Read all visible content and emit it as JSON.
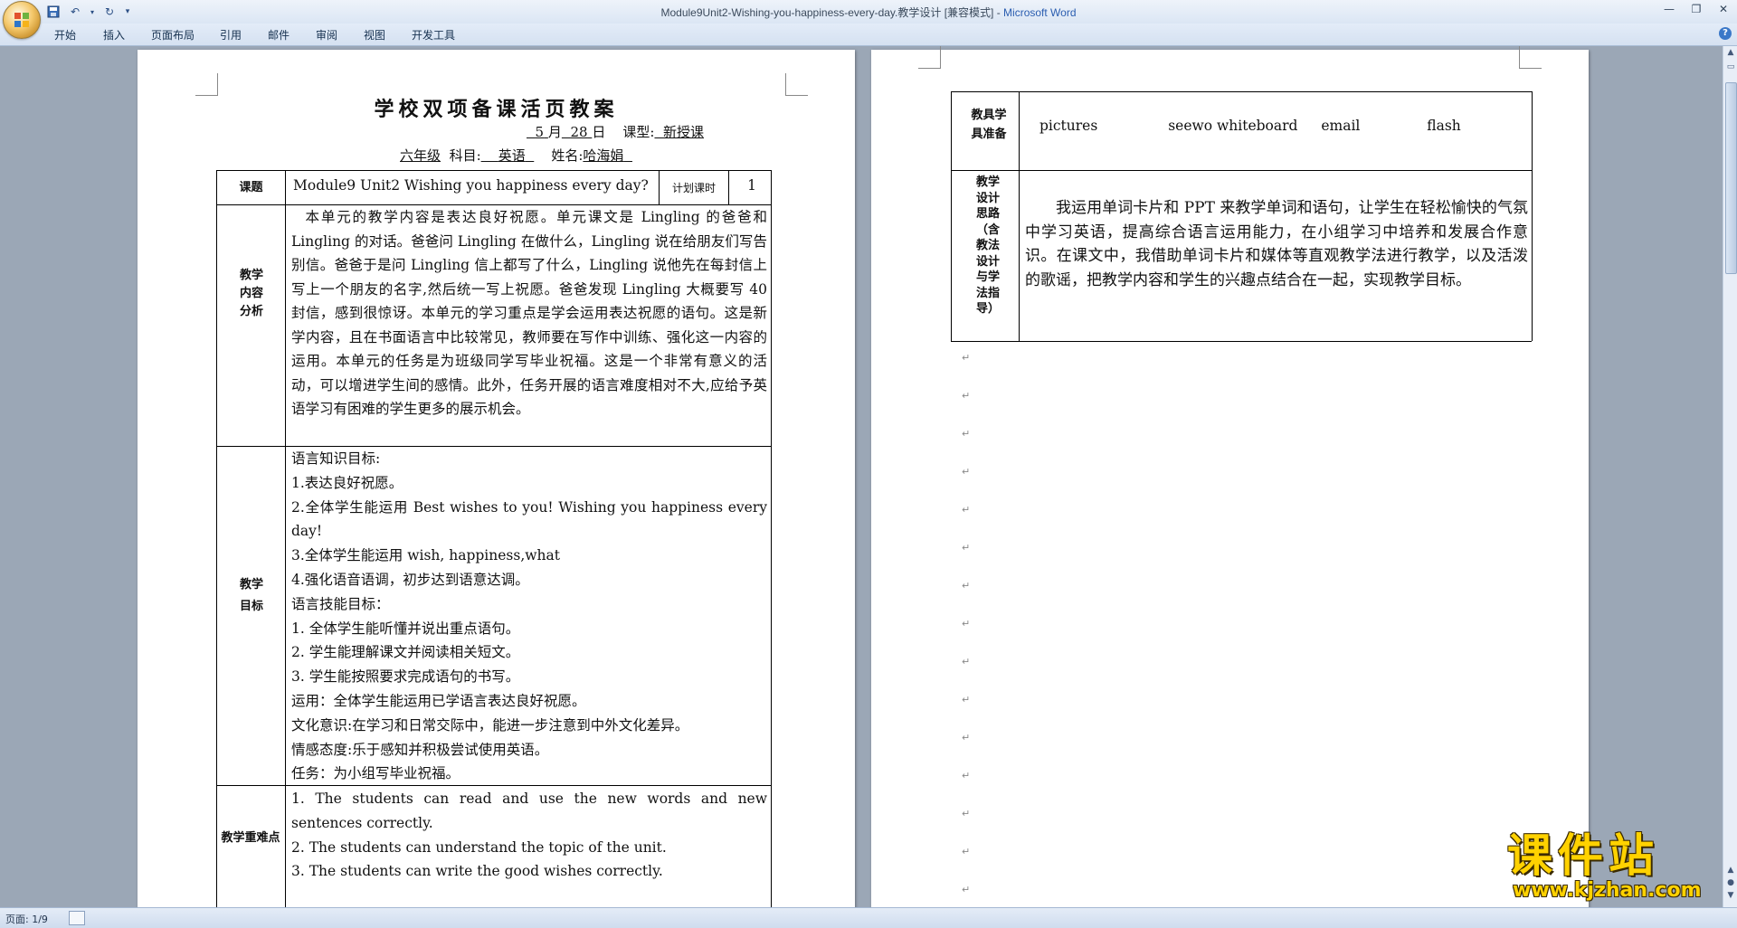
{
  "window": {
    "title": "Module9Unit2-Wishing-you-happiness-every-day.教学设计 [兼容模式] - ",
    "app_name": "Microsoft Word"
  },
  "ribbon": {
    "tabs": [
      "开始",
      "插入",
      "页面布局",
      "引用",
      "邮件",
      "审阅",
      "视图",
      "开发工具"
    ]
  },
  "status": {
    "page_label": "页面: 1/9"
  },
  "page1": {
    "title": "学校双项备课活页教案",
    "date_month": "5",
    "date_day": "28",
    "month_char": "月",
    "day_char": "日",
    "course_type_label": "课型:",
    "course_type": "新授课",
    "grade": "六年级",
    "subject_label": "科目:",
    "subject": "英语",
    "name_label": "姓名:",
    "name": "哈海娟",
    "topic_label": "课题",
    "topic": "Module9 Unit2 Wishing you happiness every day?",
    "hours_label": "计划课时",
    "hours": "1",
    "content_label": "教学内容分析",
    "content_text": "本单元的教学内容是表达良好祝愿。单元课文是 Lingling 的爸爸和 Lingling 的对话。爸爸问 Lingling 在做什么，Lingling 说在给朋友们写告别信。爸爸于是问 Lingling 信上都写了什么，Lingling 说他先在每封信上写上一个朋友的名字,然后统一写上祝愿。爸爸发现 Lingling 大概要写 40 封信，感到很惊讶。本单元的学习重点是学会运用表达祝愿的语句。这是新学内容，且在书面语言中比较常见，教师要在写作中训练、强化这一内容的运用。本单元的任务是为班级同学写毕业祝福。这是一个非常有意义的活动，可以增进学生间的感情。此外，任务开展的语言难度相对不大,应给予英语学习有困难的学生更多的展示机会。",
    "goals_label": "教学目标",
    "goals": [
      "语言知识目标:",
      "1.表达良好祝愿。",
      "2.全体学生能运用 Best wishes to you! Wishing you happiness every day!",
      "3.全体学生能运用 wish, happiness,what",
      "4.强化语音语调，初步达到语意达调。",
      "语言技能目标：",
      "1.  全体学生能听懂并说出重点语句。",
      "2.  学生能理解课文并阅读相关短文。",
      "3.  学生能按照要求完成语句的书写。",
      "运用：全体学生能运用已学语言表达良好祝愿。",
      "文化意识:在学习和日常交际中，能进一步注意到中外文化差异。",
      "情感态度:乐于感知并积极尝试使用英语。",
      "任务：为小组写毕业祝福。"
    ],
    "keypoints_label": "教学重难点",
    "keypoints": [
      "1. The students can read and use the new words and new sentences correctly.",
      "2. The students can understand the topic of the unit.",
      "3. The students can write the good wishes correctly."
    ]
  },
  "page2": {
    "tools_label": "教具学具准备",
    "tools": [
      "pictures",
      "seewo whiteboard",
      "email",
      "flash"
    ],
    "design_label": "教学设计思路（含教法设计与学法指导）",
    "design_text": "我运用单词卡片和 PPT 来教学单词和语句，让学生在轻松愉快的气氛中学习英语，提高综合语言运用能力，在小组学习中培养和发展合作意识。在课文中，我借助单词卡片和媒体等直观教学法进行教学，以及活泼的歌谣，把教学内容和学生的兴趣点结合在一起，实现教学目标。"
  },
  "watermark": {
    "main": "课件站",
    "url": "www.kjzhan.com"
  }
}
